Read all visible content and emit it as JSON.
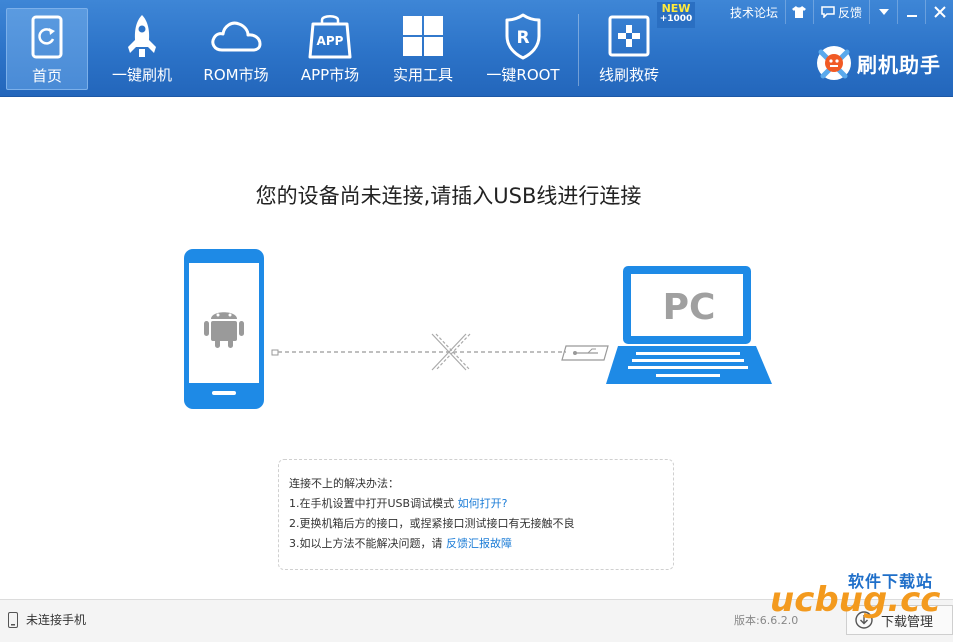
{
  "toolbar": {
    "items": [
      {
        "label": "首页",
        "icon": "home-refresh-icon"
      },
      {
        "label": "一键刷机",
        "icon": "rocket-icon"
      },
      {
        "label": "ROM市场",
        "icon": "cloud-icon"
      },
      {
        "label": "APP市场",
        "icon": "app-bag-icon",
        "icon_text": "APP"
      },
      {
        "label": "实用工具",
        "icon": "grid-tools-icon"
      },
      {
        "label": "一键ROOT",
        "icon": "root-shield-icon",
        "icon_text": "R"
      },
      {
        "label": "线刷救砖",
        "icon": "rescue-cross-icon"
      }
    ],
    "new_badge": {
      "line1": "NEW",
      "line2": "+1000"
    }
  },
  "top_links": {
    "forum": "技术论坛",
    "feedback": "反馈"
  },
  "brand": {
    "label": "刷机助手"
  },
  "main": {
    "title": "您的设备尚未连接,请插入USB线进行连接",
    "laptop_text": "PC"
  },
  "help": {
    "heading": "连接不上的解决办法：",
    "tip1_text": "1.在手机设置中打开USB调试模式 ",
    "tip1_link": "如何打开?",
    "tip2_text": "2.更换机箱后方的接口，或捏紧接口测试接口有无接触不良",
    "tip3_text": "3.如以上方法不能解决问题，请 ",
    "tip3_link": "反馈汇报故障"
  },
  "status": {
    "connection": "未连接手机",
    "version": "版本:6.6.2.0",
    "download": "下载管理"
  },
  "watermark": {
    "cn": "软件下载站",
    "en": "ucbug.cc"
  },
  "colors": {
    "toolbar_blue": "#2c73c8",
    "device_blue": "#1e8ae6",
    "link_blue": "#1a7bd6",
    "watermark_orange": "#f39a1e"
  }
}
